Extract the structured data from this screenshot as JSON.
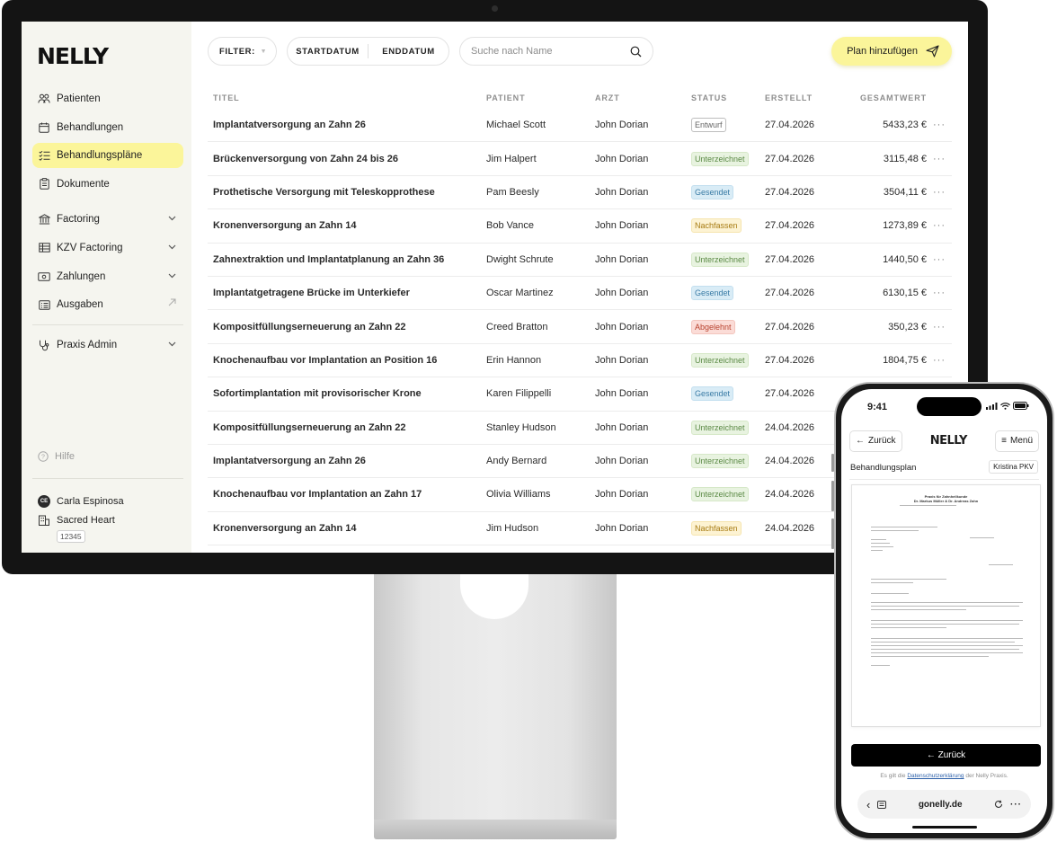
{
  "brand": {
    "name": "NELLY",
    "accent": "#fbf59a"
  },
  "sidebar": {
    "items": [
      {
        "label": "Patienten",
        "icon": "patients-icon"
      },
      {
        "label": "Behandlungen",
        "icon": "calendar-icon"
      },
      {
        "label": "Behandlungspläne",
        "icon": "checklist-icon",
        "active": true
      },
      {
        "label": "Dokumente",
        "icon": "clipboard-icon"
      },
      {
        "label": "Factoring",
        "icon": "bank-icon",
        "expandable": true
      },
      {
        "label": "KZV Factoring",
        "icon": "table-icon",
        "expandable": true
      },
      {
        "label": "Zahlungen",
        "icon": "banknote-icon",
        "expandable": true
      },
      {
        "label": "Ausgaben",
        "icon": "list-icon",
        "external": true
      },
      {
        "label": "Praxis Admin",
        "icon": "stethoscope-icon",
        "expandable": true
      }
    ],
    "help": "Hilfe",
    "user": {
      "initials": "CE",
      "name": "Carla Espinosa",
      "practice": "Sacred Heart",
      "practice_id": "12345"
    }
  },
  "toolbar": {
    "filter_label": "FILTER:",
    "start_label": "STARTDATUM",
    "end_label": "ENDDATUM",
    "search_placeholder": "Suche nach Name",
    "add_label": "Plan hinzufügen"
  },
  "table": {
    "headers": {
      "title": "TITEL",
      "patient": "PATIENT",
      "doctor": "ARZT",
      "status": "STATUS",
      "created": "ERSTELLT",
      "total": "GESAMTWERT"
    },
    "rows": [
      {
        "title": "Implantatversorgung an Zahn 26",
        "patient": "Michael Scott",
        "doctor": "John Dorian",
        "status": "Entwurf",
        "kind": "entwurf",
        "created": "27.04.2026",
        "total": "5433,23 €"
      },
      {
        "title": "Brückenversorgung von Zahn 24 bis 26",
        "patient": "Jim Halpert",
        "doctor": "John Dorian",
        "status": "Unterzeichnet",
        "kind": "unter",
        "created": "27.04.2026",
        "total": "3115,48 €"
      },
      {
        "title": "Prothetische Versorgung mit Teleskopprothese",
        "patient": "Pam Beesly",
        "doctor": "John Dorian",
        "status": "Gesendet",
        "kind": "ges",
        "created": "27.04.2026",
        "total": "3504,11 €"
      },
      {
        "title": "Kronenversorgung an Zahn 14",
        "patient": "Bob Vance",
        "doctor": "John Dorian",
        "status": "Nachfassen",
        "kind": "nach",
        "created": "27.04.2026",
        "total": "1273,89 €"
      },
      {
        "title": "Zahnextraktion und Implantatplanung an Zahn 36",
        "patient": "Dwight Schrute",
        "doctor": "John Dorian",
        "status": "Unterzeichnet",
        "kind": "unter",
        "created": "27.04.2026",
        "total": "1440,50 €"
      },
      {
        "title": "Implantatgetragene Brücke im Unterkiefer",
        "patient": "Oscar Martinez",
        "doctor": "John Dorian",
        "status": "Gesendet",
        "kind": "ges",
        "created": "27.04.2026",
        "total": "6130,15 €"
      },
      {
        "title": "Kompositfüllungserneuerung an Zahn 22",
        "patient": "Creed Bratton",
        "doctor": "John Dorian",
        "status": "Abgelehnt",
        "kind": "abg",
        "created": "27.04.2026",
        "total": "350,23 €"
      },
      {
        "title": "Knochenaufbau vor Implantation an Position 16",
        "patient": "Erin Hannon",
        "doctor": "John Dorian",
        "status": "Unterzeichnet",
        "kind": "unter",
        "created": "27.04.2026",
        "total": "1804,75 €"
      },
      {
        "title": "Sofortimplantation mit provisorischer Krone",
        "patient": "Karen Filippelli",
        "doctor": "John Dorian",
        "status": "Gesendet",
        "kind": "ges",
        "created": "27.04.2026",
        "total": ""
      },
      {
        "title": "Kompositfüllungserneuerung an Zahn 22",
        "patient": "Stanley Hudson",
        "doctor": "John Dorian",
        "status": "Unterzeichnet",
        "kind": "unter",
        "created": "24.04.2026",
        "total": ""
      },
      {
        "title": "Implantatversorgung an Zahn 26",
        "patient": "Andy Bernard",
        "doctor": "John Dorian",
        "status": "Unterzeichnet",
        "kind": "unter",
        "created": "24.04.2026",
        "total": ""
      },
      {
        "title": "Knochenaufbau vor Implantation an Zahn 17",
        "patient": "Olivia Williams",
        "doctor": "John Dorian",
        "status": "Unterzeichnet",
        "kind": "unter",
        "created": "24.04.2026",
        "total": ""
      },
      {
        "title": "Kronenversorgung an Zahn 14",
        "patient": "Jim Hudson",
        "doctor": "John Dorian",
        "status": "Nachfassen",
        "kind": "nach",
        "created": "24.04.2026",
        "total": ""
      }
    ]
  },
  "phone": {
    "time": "9:41",
    "back_label": "Zurück",
    "logo": "NELLY",
    "menu_label": "Menü",
    "plan_label": "Behandlungsplan",
    "insurance": "Kristina PKV",
    "doc": {
      "heading1": "Praxis für Zahnheilkunde",
      "heading2": "Dr. Markus Müller & Dr. Andreas Zahn"
    },
    "back_button": "← Zurück",
    "privacy_pre": "Es gilt die ",
    "privacy_link": "Datenschutzerklärung",
    "privacy_post": " der Nelly Praxis.",
    "url": "gonelly.de"
  }
}
